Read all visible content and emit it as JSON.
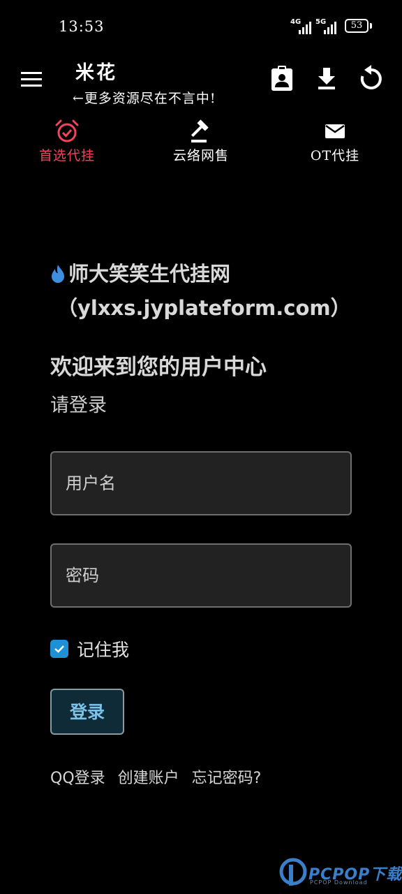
{
  "status_bar": {
    "time": "13:53",
    "network_1": "4G",
    "network_2": "5G",
    "battery": "53"
  },
  "header": {
    "title": "米花",
    "subtitle": "←更多资源尽在不言中!",
    "icons": [
      "menu-icon",
      "clipboard-account-icon",
      "download-icon",
      "refresh-icon"
    ]
  },
  "tabs": [
    {
      "label": "首选代挂",
      "icon": "alarm-check-icon",
      "active": true
    },
    {
      "label": "云络网售",
      "icon": "gavel-icon",
      "active": false
    },
    {
      "label": "OT代挂",
      "icon": "mail-icon",
      "active": false
    }
  ],
  "main": {
    "site_name": "师大笑笑生代挂网",
    "site_url": "（ylxxs.jyplateform.com）",
    "welcome": "欢迎来到您的用户中心",
    "login_prompt": "请登录",
    "username_placeholder": "用户名",
    "password_placeholder": "密码",
    "remember_label": "记住我",
    "remember_checked": true,
    "login_button": "登录",
    "links": {
      "qq_login": "QQ登录",
      "create_account": "创建账户",
      "forgot_password": "忘记密码?"
    }
  },
  "watermark": {
    "text": "PCPOP下载",
    "sub": "PCPOP Download"
  },
  "colors": {
    "background": "#000000",
    "active_tab": "#f0455a",
    "field_bg": "#222222",
    "checkbox": "#1e90d6",
    "button_text": "#7cc3ea",
    "fire_icon": "#3d8fe0"
  }
}
